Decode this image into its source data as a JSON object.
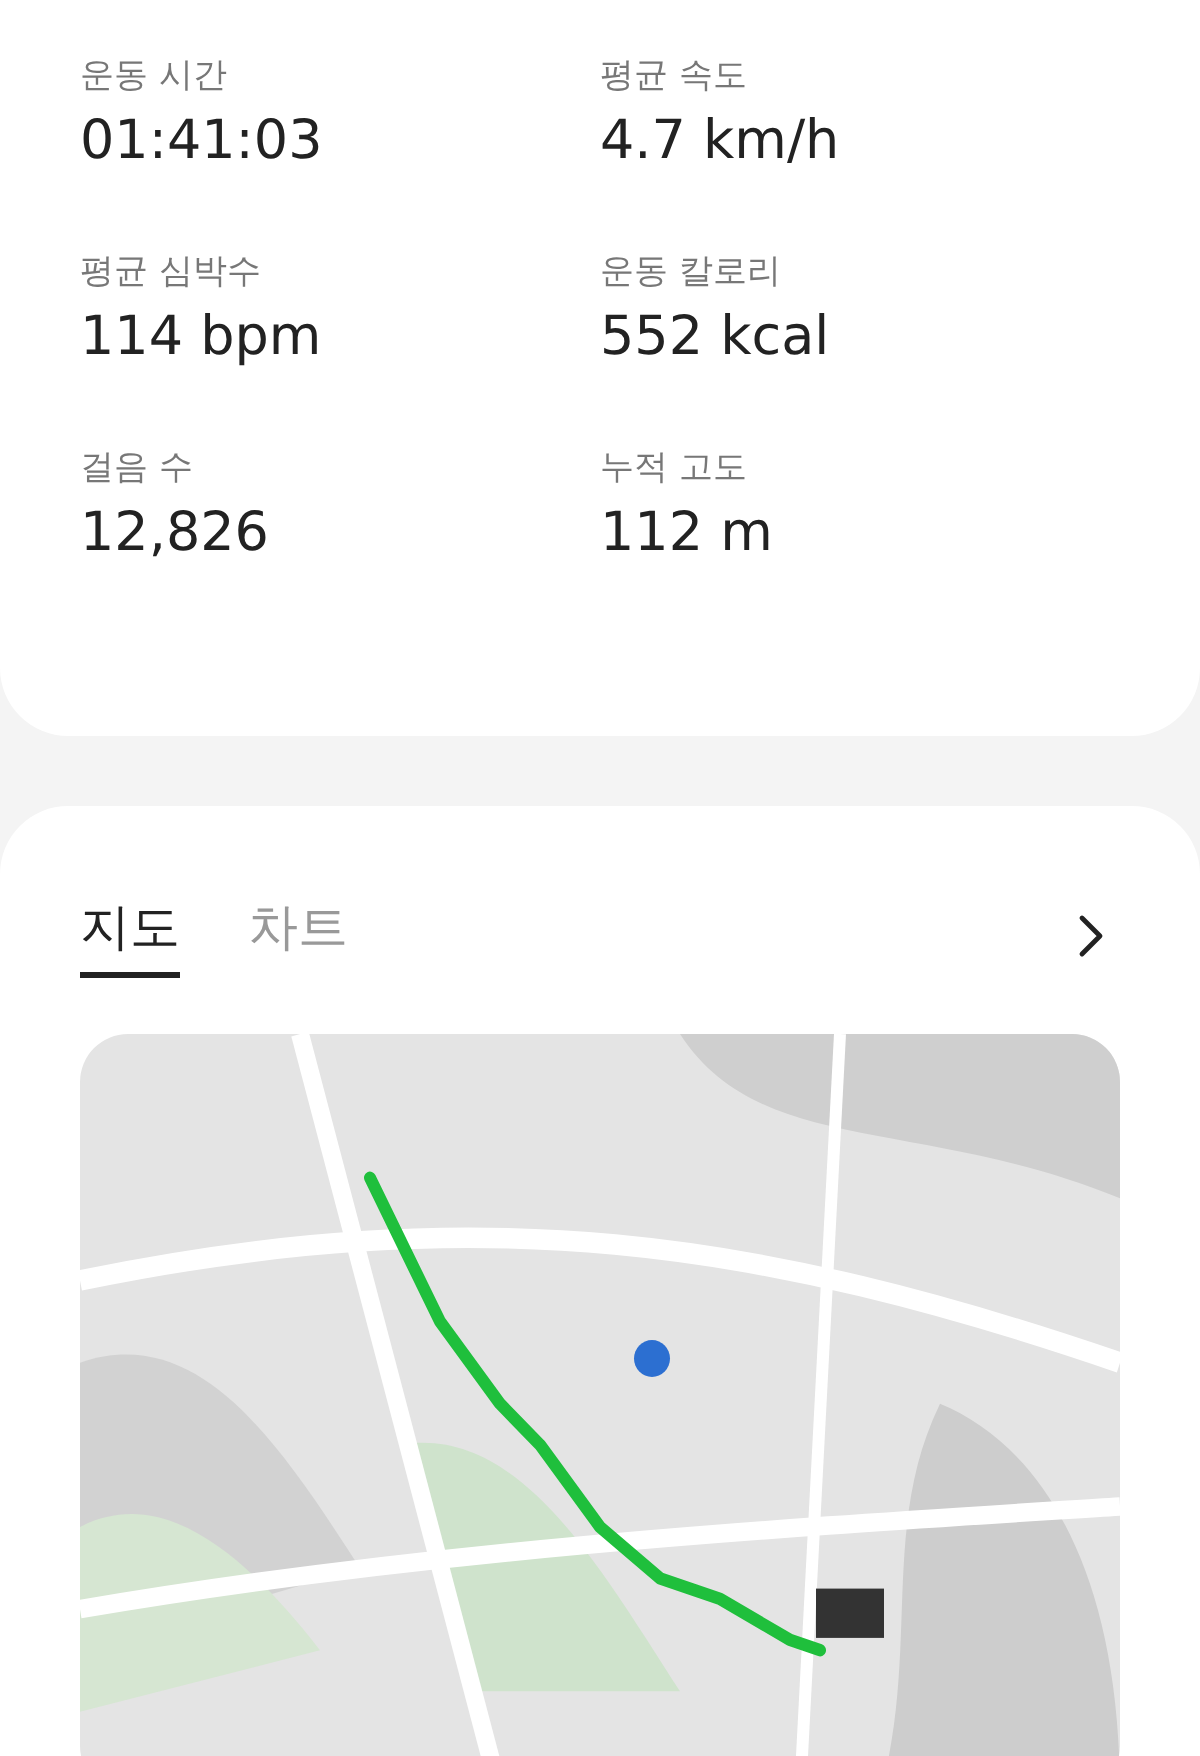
{
  "stats": [
    {
      "label": "운동 시간",
      "value": "01:41:03"
    },
    {
      "label": "평균 속도",
      "value": "4.7 km/h"
    },
    {
      "label": "평균 심박수",
      "value": "114 bpm"
    },
    {
      "label": "운동 칼로리",
      "value": "552 kcal"
    },
    {
      "label": "걸음 수",
      "value": "12,826"
    },
    {
      "label": "누적 고도",
      "value": "112 m"
    }
  ],
  "tabs": [
    {
      "label": "지도",
      "selected": true
    },
    {
      "label": "차트",
      "selected": false
    }
  ]
}
